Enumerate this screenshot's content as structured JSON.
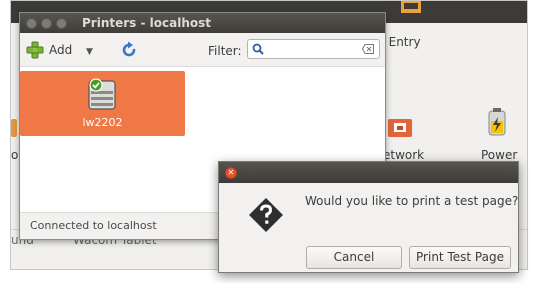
{
  "background_window": {
    "labels": {
      "text_entry": "xt Entry",
      "network": "etwork",
      "power": "Power",
      "left_ol": "ol",
      "wacom": "Wacom Tablet",
      "und": "und"
    }
  },
  "printers_window": {
    "title": "Printers - localhost",
    "toolbar": {
      "add_label": "Add",
      "add_dropdown_glyph": "▼",
      "filter_label": "Filter:",
      "filter_value": ""
    },
    "printers": [
      {
        "name": "lw2202",
        "selected": true
      }
    ],
    "status": "Connected to localhost"
  },
  "dialog": {
    "close_glyph": "✕",
    "message": "Would you like to print a test page?",
    "buttons": {
      "cancel": "Cancel",
      "print": "Print Test Page"
    }
  },
  "colors": {
    "selection": "#f07746",
    "titlebar": "#3c3b37",
    "close_button": "#e9512d"
  },
  "icons": {
    "add": "plus-icon",
    "refresh": "refresh-icon",
    "search": "search-icon",
    "clear": "clear-icon",
    "printer": "printer-icon",
    "question": "question-icon"
  }
}
